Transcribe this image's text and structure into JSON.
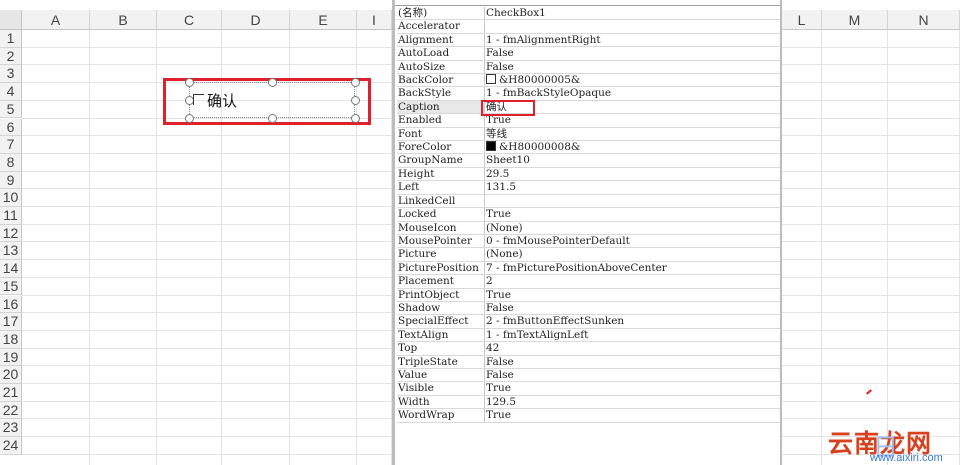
{
  "sheet": {
    "columns": [
      "A",
      "B",
      "C",
      "D",
      "E",
      "I",
      "L",
      "M",
      "N"
    ],
    "rows": [
      "1",
      "2",
      "3",
      "4",
      "5",
      "6",
      "7",
      "8",
      "9",
      "10",
      "11",
      "12",
      "13",
      "14",
      "15",
      "16",
      "17",
      "18",
      "19",
      "20",
      "21",
      "22",
      "23",
      "24"
    ]
  },
  "checkbox_control": {
    "caption": "确认"
  },
  "properties": [
    {
      "name": "(名称)",
      "value": "CheckBox1"
    },
    {
      "name": "Accelerator",
      "value": ""
    },
    {
      "name": "Alignment",
      "value": "1 - fmAlignmentRight"
    },
    {
      "name": "AutoLoad",
      "value": "False"
    },
    {
      "name": "AutoSize",
      "value": "False"
    },
    {
      "name": "BackColor",
      "value": "&H80000005&",
      "swatch": "#ffffff"
    },
    {
      "name": "BackStyle",
      "value": "1 - fmBackStyleOpaque"
    },
    {
      "name": "Caption",
      "value": "确认"
    },
    {
      "name": "Enabled",
      "value": "True"
    },
    {
      "name": "Font",
      "value": "等线"
    },
    {
      "name": "ForeColor",
      "value": "&H80000008&",
      "swatch": "#000000"
    },
    {
      "name": "GroupName",
      "value": "Sheet10"
    },
    {
      "name": "Height",
      "value": "29.5"
    },
    {
      "name": "Left",
      "value": "131.5"
    },
    {
      "name": "LinkedCell",
      "value": ""
    },
    {
      "name": "Locked",
      "value": "True"
    },
    {
      "name": "MouseIcon",
      "value": "(None)"
    },
    {
      "name": "MousePointer",
      "value": "0 - fmMousePointerDefault"
    },
    {
      "name": "Picture",
      "value": "(None)"
    },
    {
      "name": "PicturePosition",
      "value": "7 - fmPicturePositionAboveCenter"
    },
    {
      "name": "Placement",
      "value": "2"
    },
    {
      "name": "PrintObject",
      "value": "True"
    },
    {
      "name": "Shadow",
      "value": "False"
    },
    {
      "name": "SpecialEffect",
      "value": "2 - fmButtonEffectSunken"
    },
    {
      "name": "TextAlign",
      "value": "1 - fmTextAlignLeft"
    },
    {
      "name": "Top",
      "value": "42"
    },
    {
      "name": "TripleState",
      "value": "False"
    },
    {
      "name": "Value",
      "value": "False"
    },
    {
      "name": "Visible",
      "value": "True"
    },
    {
      "name": "Width",
      "value": "129.5"
    },
    {
      "name": "WordWrap",
      "value": "True"
    }
  ],
  "selected_property": "Caption",
  "watermark": {
    "title": "云南龙网",
    "subtitle": "www.aixiri.com",
    "overlay": "日"
  },
  "colors": {
    "highlight": "#e0202a"
  }
}
